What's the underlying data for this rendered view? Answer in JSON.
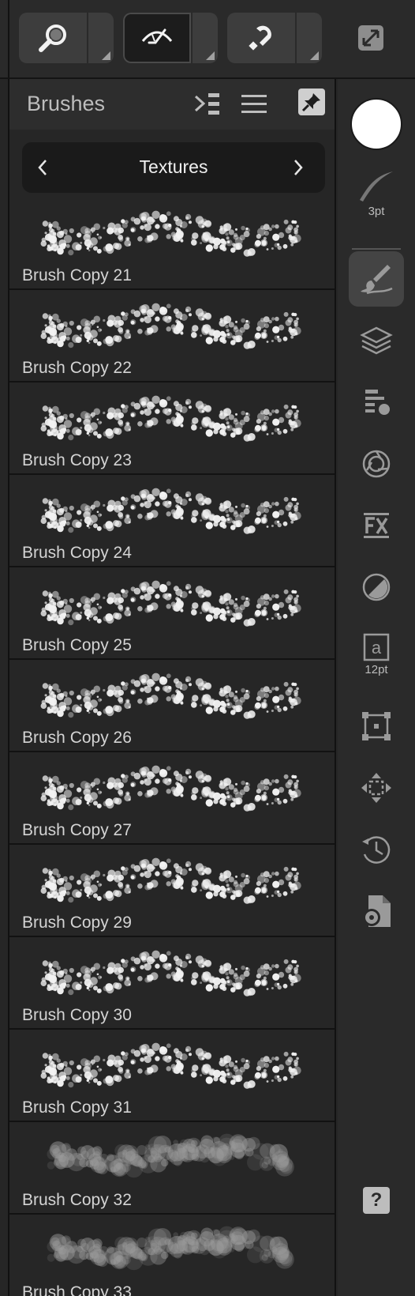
{
  "toolbar": {
    "tools": [
      {
        "name": "zoom",
        "icon": "magnifier-icon",
        "active": false
      },
      {
        "name": "view",
        "icon": "view-mode-icon",
        "active": true
      },
      {
        "name": "snapping",
        "icon": "magnet-icon",
        "active": false
      }
    ],
    "expand_icon": "expand-icon"
  },
  "panel": {
    "title": "Brushes",
    "category": "Textures",
    "prev": "<",
    "next": ">",
    "brushes": [
      {
        "name": "Brush Copy 21",
        "style": "spray"
      },
      {
        "name": "Brush Copy 22",
        "style": "spray"
      },
      {
        "name": "Brush Copy 23",
        "style": "spray"
      },
      {
        "name": "Brush Copy 24",
        "style": "spray"
      },
      {
        "name": "Brush Copy 25",
        "style": "spray"
      },
      {
        "name": "Brush Copy 26",
        "style": "spray"
      },
      {
        "name": "Brush Copy 27",
        "style": "spray"
      },
      {
        "name": "Brush Copy 29",
        "style": "spray"
      },
      {
        "name": "Brush Copy 30",
        "style": "spray"
      },
      {
        "name": "Brush Copy 31",
        "style": "spray"
      },
      {
        "name": "Brush Copy 32",
        "style": "grunge"
      },
      {
        "name": "Brush Copy 33",
        "style": "grunge"
      }
    ]
  },
  "sidebar": {
    "color": "#ffffff",
    "brush_size": "3pt",
    "text_size": "12pt",
    "help": "?"
  }
}
